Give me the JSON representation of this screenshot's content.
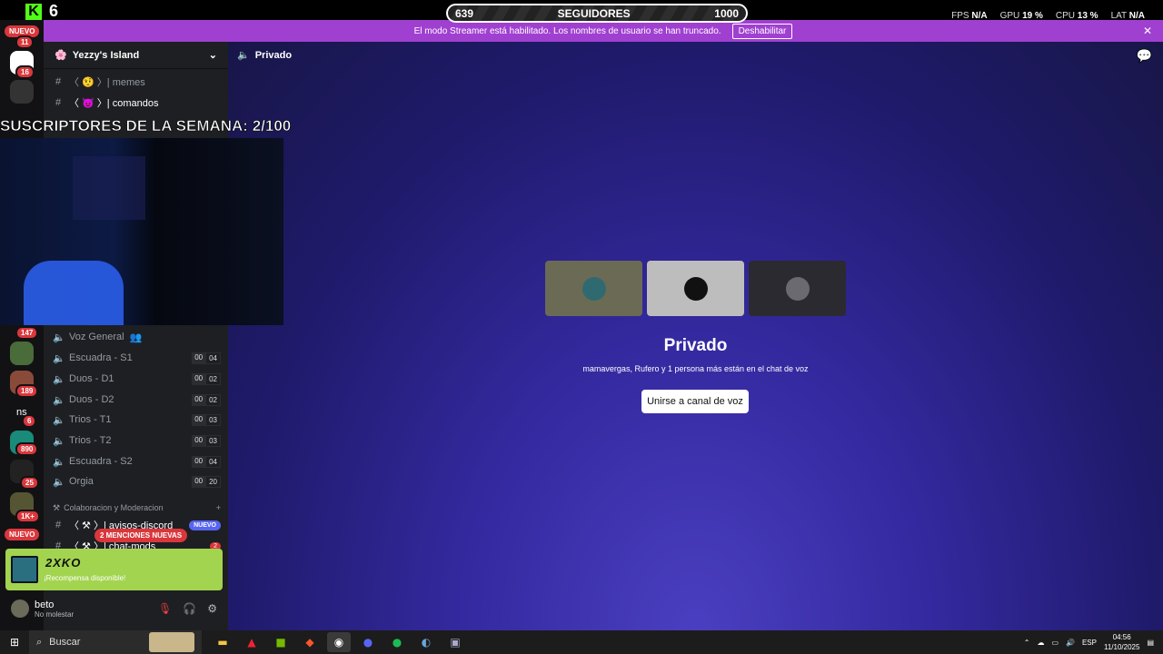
{
  "top": {
    "kick_logo": "K",
    "kick_count": "6",
    "followers_current": "639",
    "followers_label": "SEGUIDORES",
    "followers_goal": "1000",
    "fps_label": "FPS",
    "fps_value": "N/A",
    "gpu_label": "GPU",
    "gpu_value": "19 %",
    "cpu_label": "CPU",
    "cpu_value": "13 %",
    "lat_label": "LAT",
    "lat_value": "N/A"
  },
  "banner": {
    "text": "El modo Streamer está habilitado. Los nombres de usuario se han truncado.",
    "button": "Deshabilitar",
    "close": "✕"
  },
  "rail": {
    "nuevo_top": "NUEVO",
    "nuevo_bottom": "NUEVO",
    "badges": [
      "11",
      "16",
      "147",
      "189",
      "6",
      "890",
      "25",
      "1K+"
    ],
    "ns_label": "ns"
  },
  "server": {
    "name": "Yezzy's Island"
  },
  "channels_text": [
    {
      "icon": "#",
      "label": "〈 🤨 〉| memes"
    },
    {
      "icon": "#",
      "label": "〈 😈 〉| comandos"
    }
  ],
  "voice_channels": [
    {
      "label": "Voz General",
      "a": "",
      "b": ""
    },
    {
      "label": "Escuadra - S1",
      "a": "00",
      "b": "04"
    },
    {
      "label": "Duos - D1",
      "a": "00",
      "b": "02"
    },
    {
      "label": "Duos - D2",
      "a": "00",
      "b": "02"
    },
    {
      "label": "Trios - T1",
      "a": "00",
      "b": "03"
    },
    {
      "label": "Trios - T2",
      "a": "00",
      "b": "03"
    },
    {
      "label": "Escuadra - S2",
      "a": "00",
      "b": "04"
    },
    {
      "label": "Orgia",
      "a": "00",
      "b": "20"
    }
  ],
  "category": {
    "label": "Colaboracion y Moderacion",
    "plus": "+"
  },
  "lower_channels": [
    {
      "label": "〈 ⚒ 〉| avisos-discord",
      "tag": "NUEVO"
    },
    {
      "label": "〈 ⚒ 〉| chat-mods",
      "tag": "2"
    }
  ],
  "mentions": "2 MENCIONES NUEVAS",
  "reward": {
    "logo": "2XKO",
    "text": "¡Recompensa disponible!"
  },
  "user": {
    "name": "beto",
    "status": "No molestar"
  },
  "overlay": {
    "title": "SUSCRIPTORES DE LA SEMANA: 2/100"
  },
  "main": {
    "channel_name": "Privado",
    "voice_title": "Privado",
    "voice_sub": "mamavergas, Rufero y 1 persona más están en el chat de voz",
    "join_button": "Unirse a canal de voz"
  },
  "taskbar": {
    "search": "Buscar",
    "lang": "ESP",
    "time": "04:56",
    "date": "11/10/2025"
  }
}
